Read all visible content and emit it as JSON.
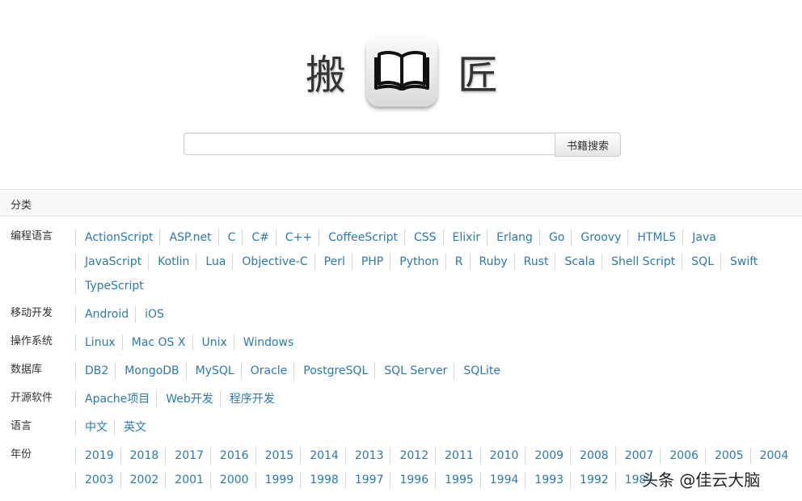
{
  "logo": {
    "left_char": "搬",
    "right_char": "匠",
    "book_icon": "open-book-icon"
  },
  "search": {
    "value": "",
    "placeholder": "",
    "button_label": "书籍搜索"
  },
  "categories_panel": {
    "title": "分类",
    "rows": [
      {
        "label": "编程语言",
        "lines": [
          [
            "ActionScript",
            "ASP.net",
            "C",
            "C#",
            "C++",
            "CoffeeScript",
            "CSS",
            "Elixir",
            "Erlang",
            "Go",
            "Groovy",
            "HTML5",
            "Java"
          ],
          [
            "JavaScript",
            "Kotlin",
            "Lua",
            "Objective-C",
            "Perl",
            "PHP",
            "Python",
            "R",
            "Ruby",
            "Rust",
            "Scala",
            "Shell Script",
            "SQL",
            "Swift"
          ],
          [
            "TypeScript"
          ]
        ]
      },
      {
        "label": "移动开发",
        "lines": [
          [
            "Android",
            "iOS"
          ]
        ]
      },
      {
        "label": "操作系统",
        "lines": [
          [
            "Linux",
            "Mac OS X",
            "Unix",
            "Windows"
          ]
        ]
      },
      {
        "label": "数据库",
        "lines": [
          [
            "DB2",
            "MongoDB",
            "MySQL",
            "Oracle",
            "PostgreSQL",
            "SQL Server",
            "SQLite"
          ]
        ]
      },
      {
        "label": "开源软件",
        "lines": [
          [
            "Apache项目",
            "Web开发",
            "程序开发"
          ]
        ]
      },
      {
        "label": "语言",
        "lines": [
          [
            "中文",
            "英文"
          ]
        ]
      },
      {
        "label": "年份",
        "lines": [
          [
            "2019",
            "2018",
            "2017",
            "2016",
            "2015",
            "2014",
            "2013",
            "2012",
            "2011",
            "2010",
            "2009",
            "2008",
            "2007",
            "2006",
            "2005",
            "2004"
          ],
          [
            "2003",
            "2002",
            "2001",
            "2000",
            "1999",
            "1998",
            "1997",
            "1996",
            "1995",
            "1994",
            "1993",
            "1992",
            "1988"
          ]
        ]
      }
    ]
  },
  "watermark": "头条 @佳云大脑",
  "colors": {
    "link": "#2a7ab0",
    "text": "#333333",
    "separator": "#d6d6d6",
    "header_bg": "#f8f8f8"
  }
}
